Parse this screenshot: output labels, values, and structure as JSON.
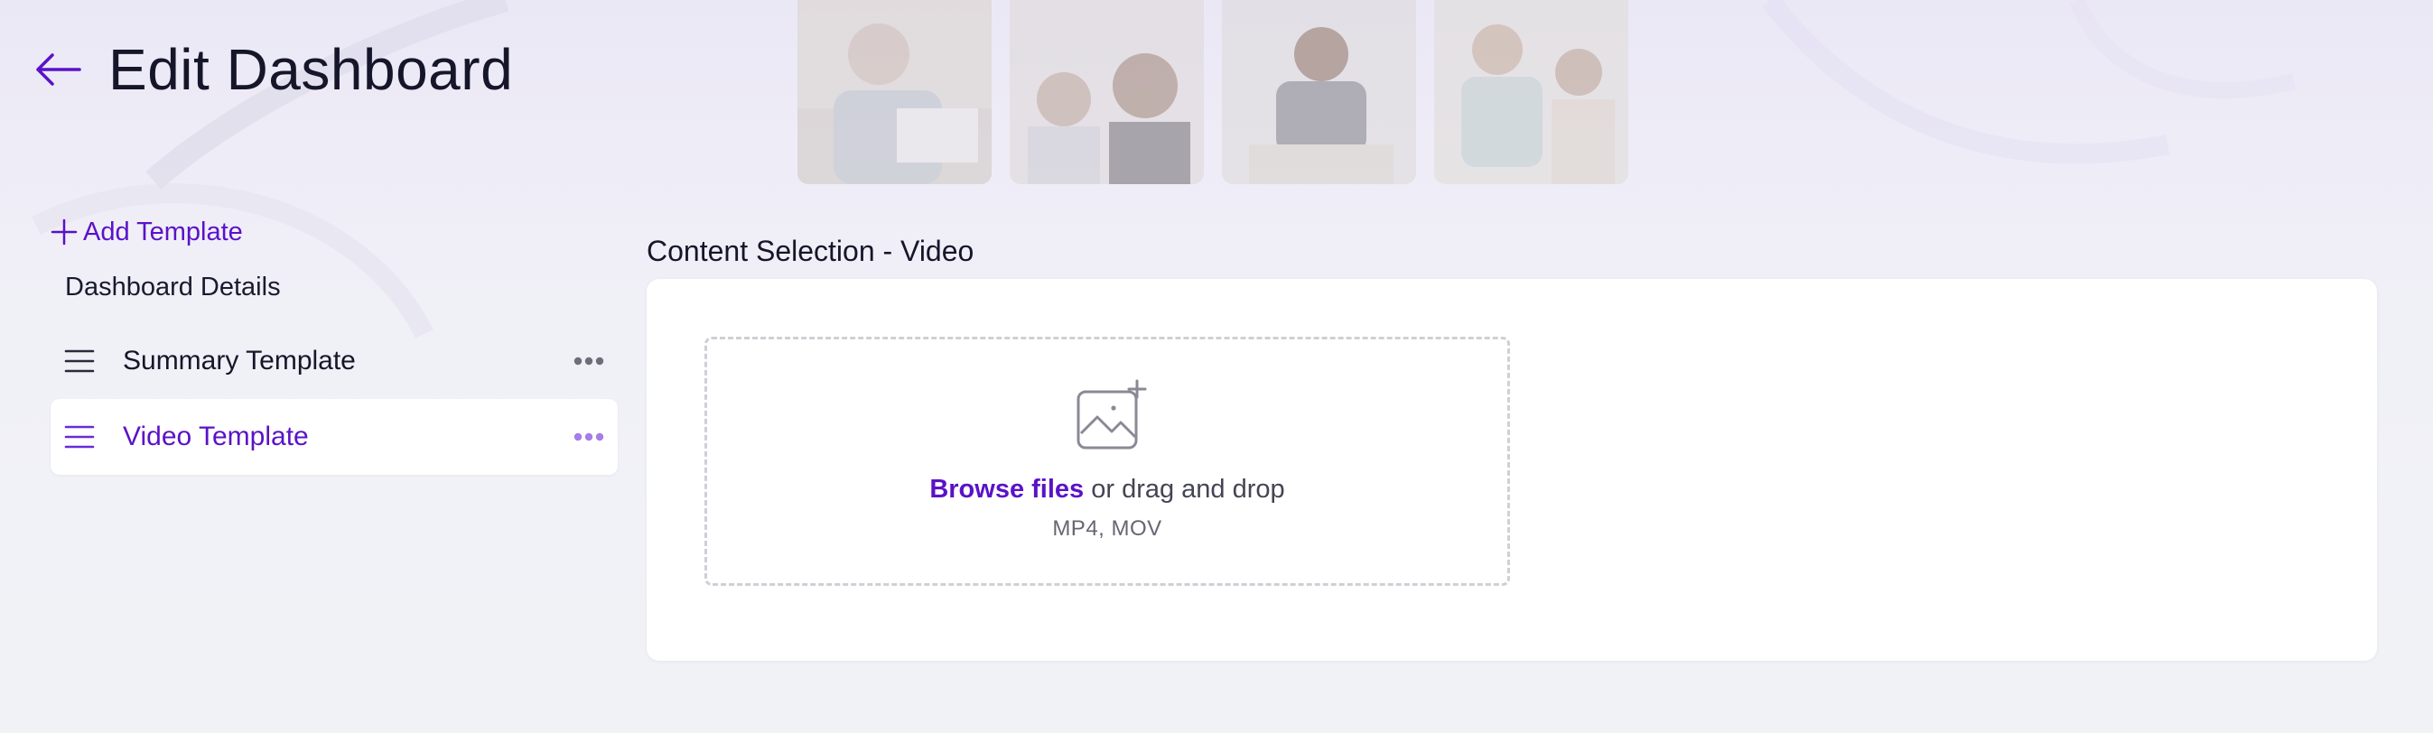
{
  "header": {
    "title": "Edit Dashboard",
    "back_icon": "arrow-left-icon"
  },
  "sidebar": {
    "add_template_label": "Add Template",
    "section_label": "Dashboard Details",
    "items": [
      {
        "label": "Summary Template",
        "active": false
      },
      {
        "label": "Video Template",
        "active": true
      }
    ]
  },
  "main": {
    "section_title": "Content Selection - Video",
    "dropzone": {
      "browse_label": "Browse files",
      "drag_text": " or drag and drop",
      "formats": "MP4, MOV"
    }
  },
  "colors": {
    "accent": "#5a12c8",
    "text": "#16162a",
    "background": "#f1f2f6",
    "card": "#ffffff"
  }
}
